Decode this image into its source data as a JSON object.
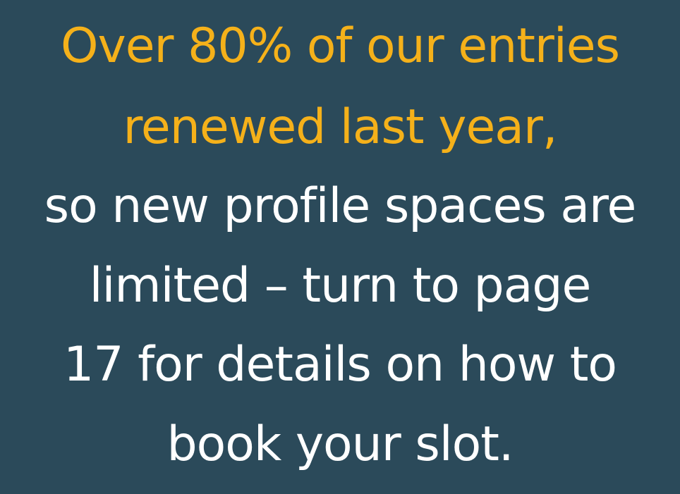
{
  "headline": {
    "line1": "Over 80% of our entries",
    "line2": "renewed last year,"
  },
  "body": {
    "line1": "so new profile spaces are",
    "line2": "limited – turn to page",
    "line3": "17 for details on how to",
    "line4": "book your slot."
  },
  "colors": {
    "background": "#2b4a5a",
    "accent": "#f5b11a",
    "text": "#ffffff"
  }
}
